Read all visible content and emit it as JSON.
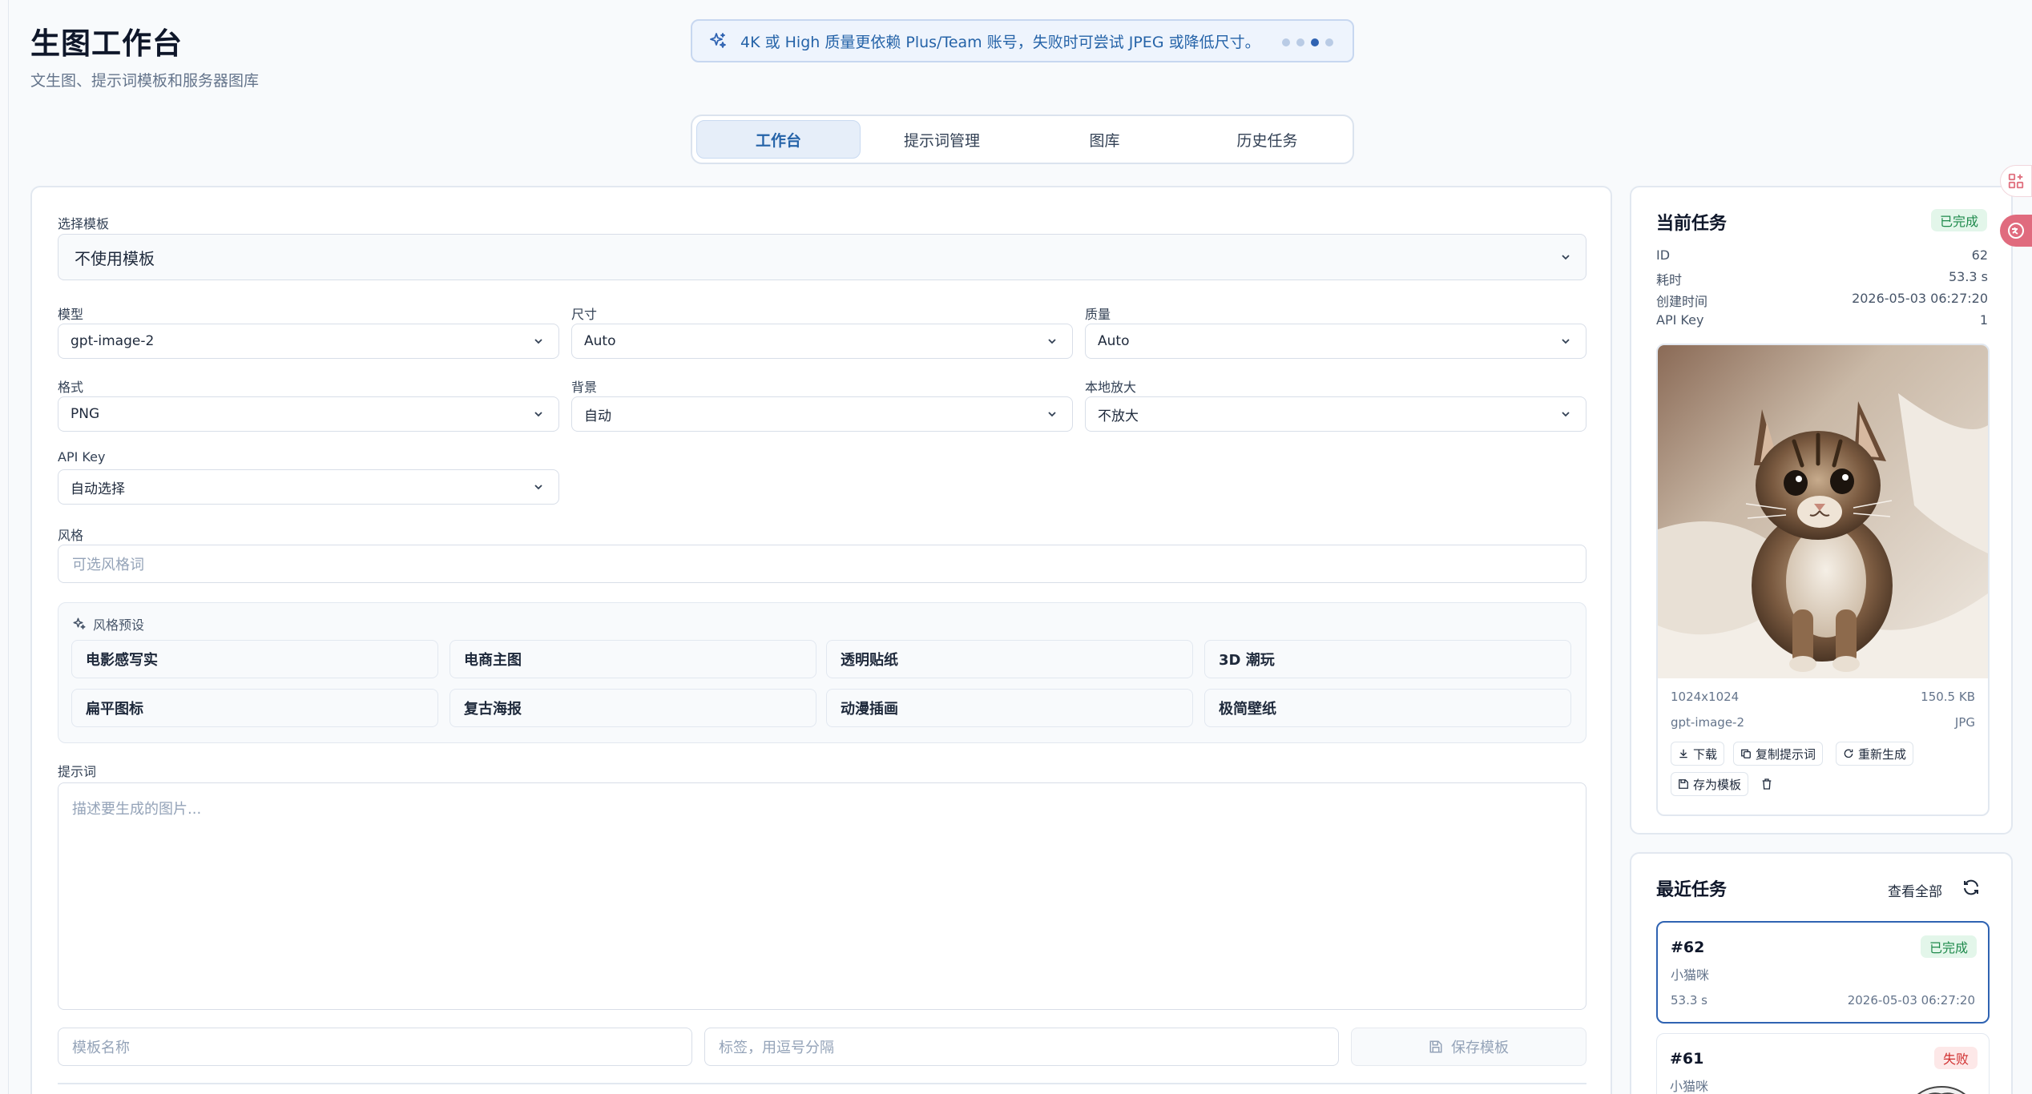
{
  "header": {
    "title": "生图工作台",
    "subtitle": "文生图、提示词模板和服务器图库",
    "notice": "4K 或 High 质量更依赖 Plus/Team 账号，失败时可尝试 JPEG 或降低尺寸。"
  },
  "tabs": [
    {
      "label": "工作台",
      "active": true
    },
    {
      "label": "提示词管理",
      "active": false
    },
    {
      "label": "图库",
      "active": false
    },
    {
      "label": "历史任务",
      "active": false
    }
  ],
  "form": {
    "template_label": "选择模板",
    "template_value": "不使用模板",
    "model_label": "模型",
    "model_value": "gpt-image-2",
    "size_label": "尺寸",
    "size_value": "Auto",
    "quality_label": "质量",
    "quality_value": "Auto",
    "format_label": "格式",
    "format_value": "PNG",
    "background_label": "背景",
    "background_value": "自动",
    "upscale_label": "本地放大",
    "upscale_value": "不放大",
    "apikey_label": "API Key",
    "apikey_value": "自动选择",
    "style_label": "风格",
    "style_placeholder": "可选风格词",
    "preset_title": "风格预设",
    "presets": [
      "电影感写实",
      "电商主图",
      "透明贴纸",
      "3D 潮玩",
      "扁平图标",
      "复古海报",
      "动漫插画",
      "极简壁纸"
    ],
    "prompt_label": "提示词",
    "prompt_placeholder": "描述要生成的图片...",
    "template_name_placeholder": "模板名称",
    "tags_placeholder": "标签，用逗号分隔",
    "save_template": "保存模板"
  },
  "current_task": {
    "title": "当前任务",
    "status": "已完成",
    "rows": [
      {
        "key": "ID",
        "value": "62"
      },
      {
        "key": "耗时",
        "value": "53.3 s"
      },
      {
        "key": "创建时间",
        "value": "2026-05-03 06:27:20"
      },
      {
        "key": "API Key",
        "value": "1"
      }
    ],
    "image": {
      "resolution": "1024x1024",
      "filesize": "150.5 KB",
      "model": "gpt-image-2",
      "format": "JPG"
    },
    "actions": {
      "download": "下载",
      "copy_prompt": "复制提示词",
      "regenerate": "重新生成",
      "save_template": "存为模板"
    }
  },
  "recent": {
    "title": "最近任务",
    "view_all": "查看全部",
    "items": [
      {
        "id": "#62",
        "status": "已完成",
        "prompt": "小猫咪",
        "duration": "53.3 s",
        "time": "2026-05-03 06:27:20"
      },
      {
        "id": "#61",
        "status": "失败",
        "prompt": "小猫咪"
      }
    ]
  },
  "colors": {
    "accent": "#2f63b2",
    "success": "#1f8a4c",
    "danger": "#d03030"
  }
}
